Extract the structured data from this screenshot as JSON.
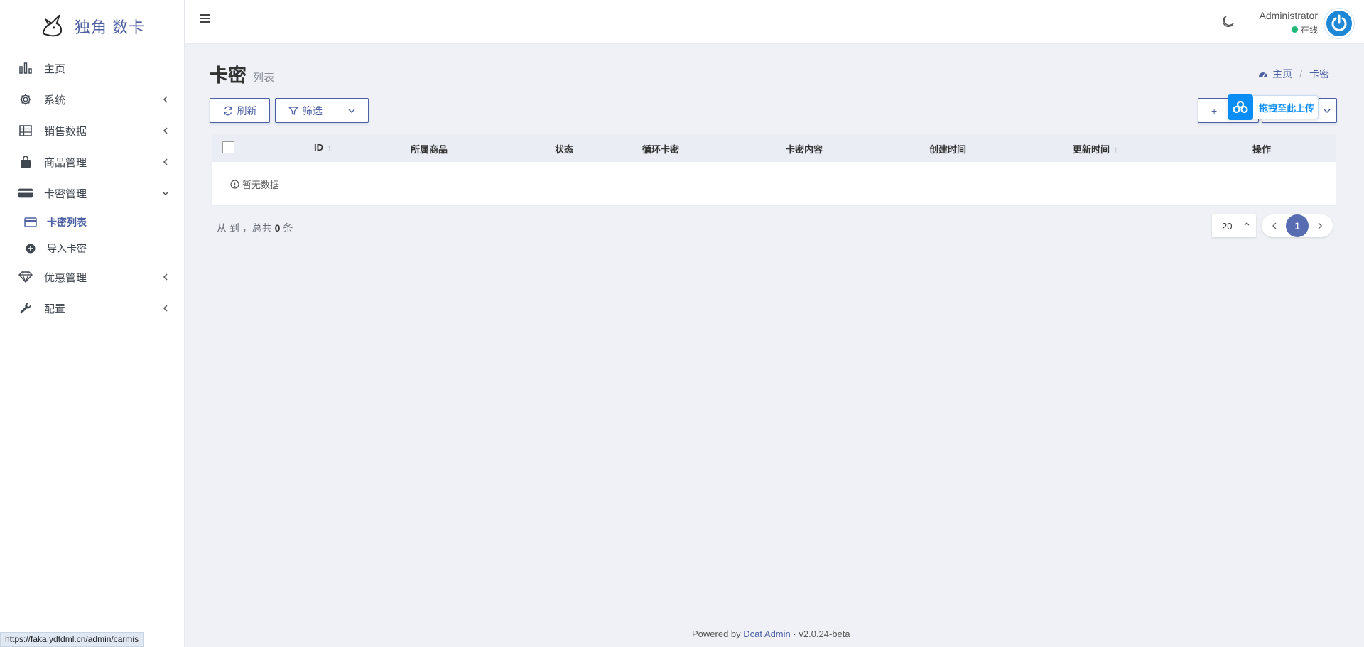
{
  "brand": {
    "name": "独角 数卡"
  },
  "sidebar": {
    "items": [
      {
        "label": "主页",
        "icon": "bar-chart-icon"
      },
      {
        "label": "系统",
        "icon": "gear-icon"
      },
      {
        "label": "销售数据",
        "icon": "table-icon"
      },
      {
        "label": "商品管理",
        "icon": "shopping-bag-icon"
      },
      {
        "label": "卡密管理",
        "icon": "credit-card-icon"
      },
      {
        "label": "优惠管理",
        "icon": "diamond-icon"
      },
      {
        "label": "配置",
        "icon": "wrench-icon"
      }
    ],
    "subitems": [
      {
        "label": "卡密列表",
        "icon": "card-icon",
        "active": true
      },
      {
        "label": "导入卡密",
        "icon": "plus-circle-icon"
      }
    ]
  },
  "navbar": {
    "user_name": "Administrator",
    "user_status": "在线",
    "status_color": "#21b978"
  },
  "page": {
    "title": "卡密",
    "subtitle": "列表",
    "breadcrumb": [
      "主页",
      "卡密"
    ]
  },
  "toolbar": {
    "refresh_label": "刷新",
    "filter_label": "筛选",
    "new_label": "+",
    "upload_label": "拖拽至此上传"
  },
  "table": {
    "columns": [
      "ID",
      "所属商品",
      "状态",
      "循环卡密",
      "卡密内容",
      "创建时间",
      "更新时间",
      "操作"
    ],
    "empty_text": "暂无数据"
  },
  "pagination": {
    "summary_prefix": "从 到 ，总共",
    "total": "0",
    "summary_suffix": "条",
    "per_page": "20",
    "current_page": "1"
  },
  "footer": {
    "powered_by": "Powered by",
    "link": "Dcat Admin",
    "sep": "·",
    "version": "v2.0.24-beta"
  },
  "statusbar": {
    "url": "https://faka.ydtdml.cn/admin/carmis"
  },
  "colors": {
    "accent": "#4c60a3",
    "upload_blue": "#0a8ef5",
    "background": "#eff1f6"
  }
}
